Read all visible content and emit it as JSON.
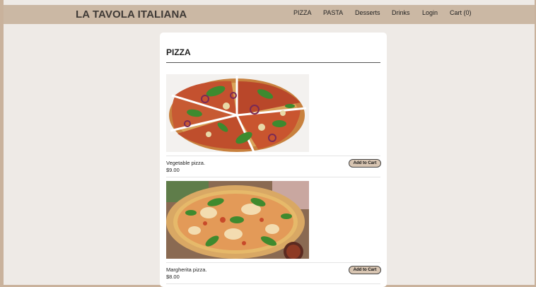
{
  "header": {
    "brand": "LA TAVOLA ITALIANA",
    "nav": {
      "pizza": "PIZZA",
      "pasta": "PASTA",
      "desserts": "Desserts",
      "drinks": "Drinks",
      "login": "Login",
      "cart": "Cart (0)"
    }
  },
  "section": {
    "title": "PIZZA",
    "items": [
      {
        "name": "Vegetable pizza.",
        "price": "$9.00",
        "button": "Add to Cart",
        "image": "vegetable-pizza-photo"
      },
      {
        "name": "Margherita pizza.",
        "price": "$8.00",
        "button": "Add to Cart",
        "image": "margherita-pizza-photo"
      }
    ]
  },
  "colors": {
    "navbar": "#cbb8a4",
    "page_background": "#eeeae6",
    "outer_background": "#c9b29c",
    "button_fill": "#d8c5b2"
  }
}
